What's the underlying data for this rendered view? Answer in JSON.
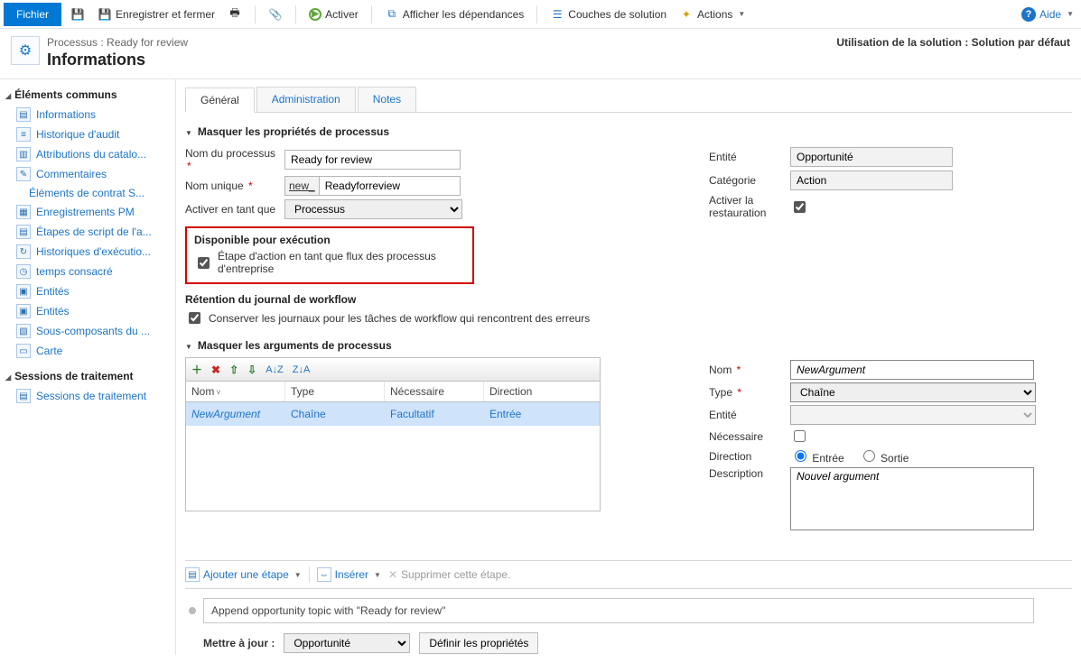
{
  "toolbar": {
    "file": "Fichier",
    "save_close": "Enregistrer et fermer",
    "activate": "Activer",
    "show_deps": "Afficher les dépendances",
    "layers": "Couches de solution",
    "actions": "Actions",
    "help": "Aide"
  },
  "header": {
    "breadcrumb": "Processus : Ready for review",
    "title": "Informations",
    "solution_usage": "Utilisation de la solution : Solution par défaut"
  },
  "sidebar": {
    "section1": "Éléments communs",
    "items1": [
      "Informations",
      "Historique d'audit",
      "Attributions du catalo...",
      "Commentaires",
      "Éléments de contrat S...",
      "Enregistrements PM",
      "Étapes de script de l'a...",
      "Historiques d'exécutio...",
      "temps consacré",
      "Entités",
      "Entités",
      "Sous-composants du ...",
      "Carte"
    ],
    "section2": "Sessions de traitement",
    "items2": [
      "Sessions de traitement"
    ]
  },
  "tabs": {
    "general": "Général",
    "admin": "Administration",
    "notes": "Notes"
  },
  "main": {
    "hide_props": "Masquer les propriétés de processus",
    "proc_name_label": "Nom du processus",
    "proc_name_value": "Ready for review",
    "unique_label": "Nom unique",
    "unique_prefix": "new_",
    "unique_value": "Readyforreview",
    "activate_as_label": "Activer en tant que",
    "activate_as_value": "Processus",
    "avail_title": "Disponible pour exécution",
    "avail_chk": "Étape d'action en tant que flux des processus d'entreprise",
    "retain_title": "Rétention du journal de workflow",
    "retain_chk": "Conserver les journaux pour les tâches de workflow qui rencontrent des erreurs",
    "entity_label": "Entité",
    "entity_value": "Opportunité",
    "cat_label": "Catégorie",
    "cat_value": "Action",
    "restore_label_1": "Activer la",
    "restore_label_2": "restauration",
    "hide_args": "Masquer les arguments de processus",
    "args": {
      "headers": {
        "name": "Nom",
        "type": "Type",
        "req": "Nécessaire",
        "dir": "Direction"
      },
      "row": {
        "name": "NewArgument",
        "type": "Chaîne",
        "req": "Facultatif",
        "dir": "Entrée"
      }
    },
    "argprops": {
      "name_label": "Nom",
      "name_value": "NewArgument",
      "type_label": "Type",
      "type_value": "Chaîne",
      "entity_label": "Entité",
      "req_label": "Nécessaire",
      "dir_label": "Direction",
      "dir_in": "Entrée",
      "dir_out": "Sortie",
      "desc_label": "Description",
      "desc_value": "Nouvel argument"
    }
  },
  "steps": {
    "add": "Ajouter une étape",
    "insert": "Insérer",
    "delete": "Supprimer cette étape.",
    "desc": "Append opportunity topic with \"Ready for review\"",
    "update_label": "Mettre à jour :",
    "update_value": "Opportunité",
    "set_props": "Définir les propriétés"
  }
}
